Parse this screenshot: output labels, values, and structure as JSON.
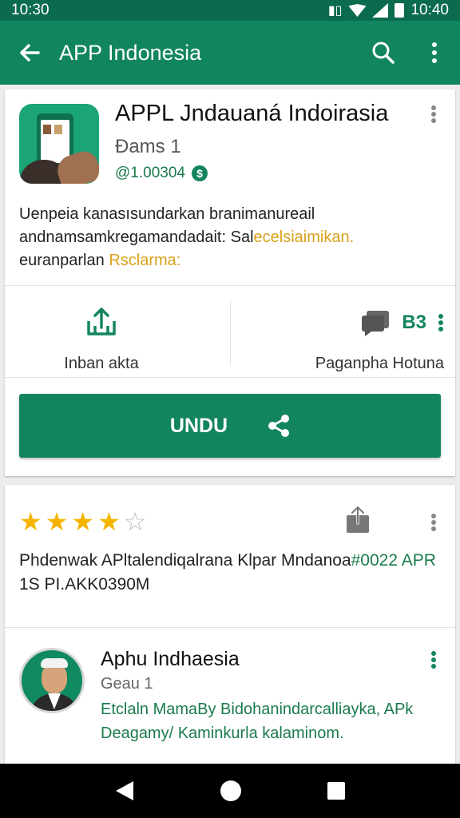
{
  "status_bar": {
    "time_left": "10:30",
    "time_right": "10:40"
  },
  "app_bar": {
    "title": "APP Indonesia"
  },
  "app": {
    "title": "APPL Jndauaná Indoirasia",
    "developer": "Đams 1",
    "version": "@1.00304",
    "description_lines": [
      {
        "text": "Uenpeia kanasısundarkan branimanureail",
        "highlight": ""
      },
      {
        "text": "andnamsamkregamandadait: Sal",
        "highlight": "ecelsiaimikan."
      },
      {
        "text": "euranparlan ",
        "highlight": "Rsclarma:"
      }
    ]
  },
  "actions": {
    "share_label": "Inban akta",
    "right_label": "Paganpha Hotuna",
    "right_icon_text": "B3"
  },
  "install_button": {
    "label": "UNDU"
  },
  "review": {
    "rating": 4,
    "max_rating": 5,
    "line1": "Phdenwak APltalendiqalrana Klpar Mndanoa",
    "line1_highlight": "#0022 APR",
    "line2": "1S PI.AKK0390M"
  },
  "user": {
    "title": "Aphu Indhaesia",
    "subtitle": "Geau 1",
    "text_lines": [
      "Etclaln MamaBy Bidohanindarcalliayka, APk",
      "Deagamy/ Kaminkurla kalaminom."
    ]
  },
  "colors": {
    "primary": "#11855f",
    "primary_dark": "#0b6b4f",
    "star": "#f4b400",
    "highlight_yellow": "#d9a21b",
    "highlight_green": "#1a7a4a"
  },
  "icons": {
    "back": "arrow-left-icon",
    "search": "search-icon",
    "more": "more-vert-icon",
    "share": "share-upload-icon",
    "chat": "chat-icon",
    "install_share": "share-nodes-icon",
    "export": "export-icon",
    "nav_back": "triangle-back-icon",
    "nav_home": "circle-home-icon",
    "nav_recent": "square-recent-icon"
  }
}
